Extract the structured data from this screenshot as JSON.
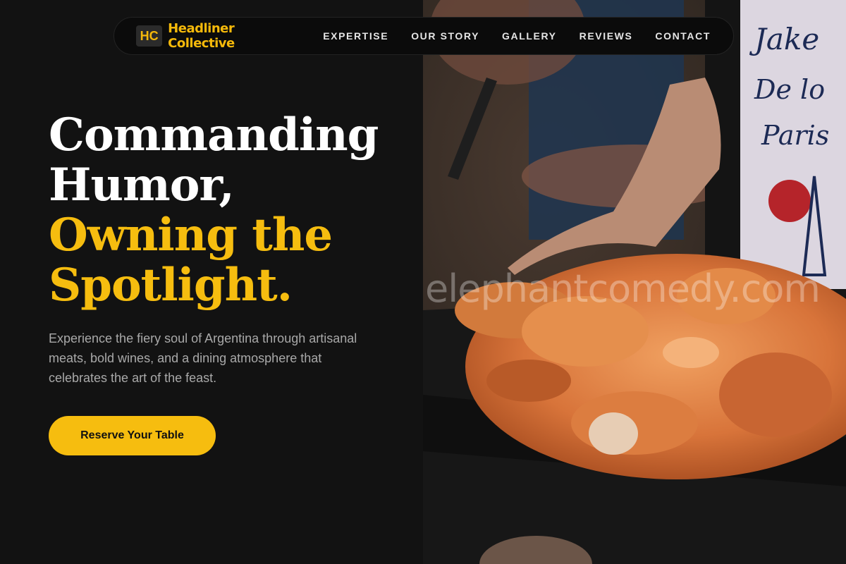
{
  "brand": {
    "logo_initials": "HC",
    "name": "Headliner Collective"
  },
  "nav": {
    "links": [
      {
        "label": "EXPERTISE"
      },
      {
        "label": "OUR STORY"
      },
      {
        "label": "GALLERY"
      },
      {
        "label": "REVIEWS"
      },
      {
        "label": "CONTACT"
      }
    ]
  },
  "hero": {
    "headline_line1": "Commanding",
    "headline_line2": "Humor,",
    "headline_line3": "Owning the",
    "headline_line4": "Spotlight.",
    "description": "Experience the fiery soul of Argentina through artisanal meats, bold wines, and a dining atmosphere that celebrates the art of the feast.",
    "cta_label": "Reserve Your Table",
    "image_watermark": "elephantcomedy.com"
  },
  "colors": {
    "accent": "#f6bd0f",
    "background": "#121212",
    "nav_background": "#0b0b0b",
    "text_primary": "#ffffff",
    "text_muted": "#a9a9a9"
  }
}
